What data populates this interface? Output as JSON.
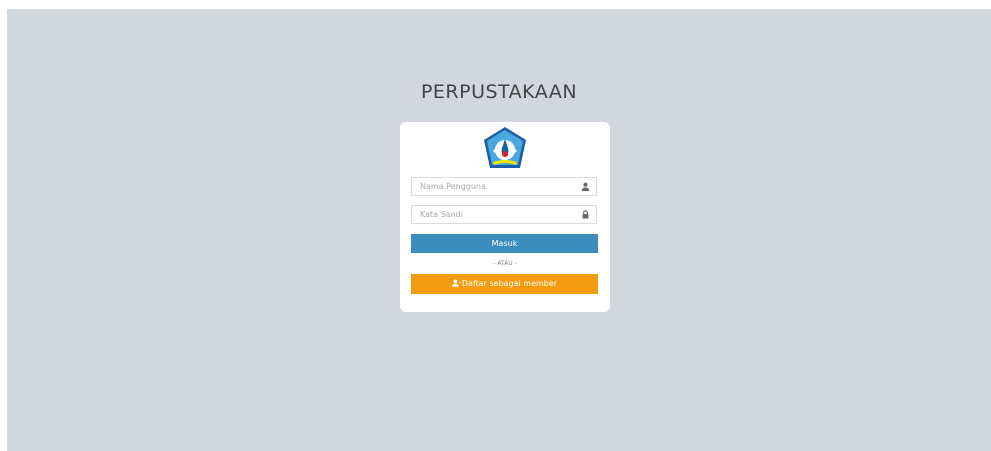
{
  "app": {
    "title": "PERPUSTAKAAN"
  },
  "login": {
    "logo_icon": "tut-wuri-handayani-logo",
    "username": {
      "placeholder": "Nama Pengguna",
      "value": "",
      "icon": "user-icon"
    },
    "password": {
      "placeholder": "Kata Sandi",
      "value": "",
      "icon": "lock-icon"
    },
    "submit_label": "Masuk",
    "separator_text": "- ATAU -",
    "register": {
      "label": "Daftar sebagai member",
      "icon": "user-plus-icon"
    }
  },
  "colors": {
    "background": "#d2d6de",
    "card": "#ffffff",
    "primary": "#3c8dbc",
    "warning": "#f39c12"
  }
}
